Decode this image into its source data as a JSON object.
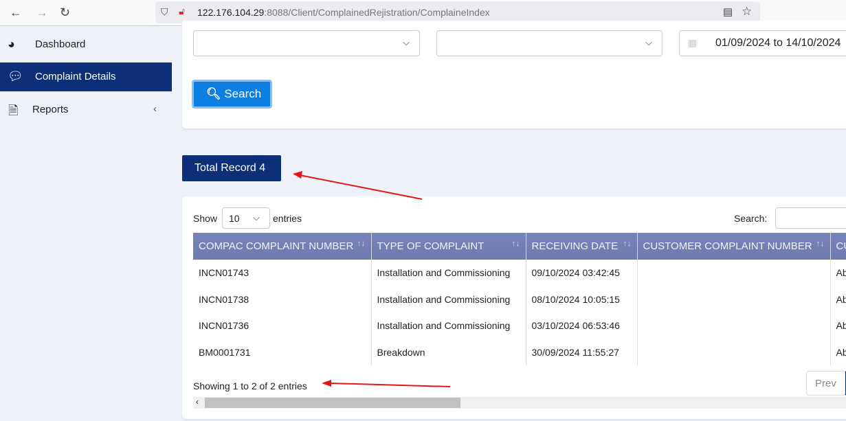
{
  "browser": {
    "url_host": "122.176.104.29",
    "url_path": ":8088/Client/ComplainedRejistration/ComplaineIndex"
  },
  "sidebar": {
    "items": [
      {
        "label": "Dashboard",
        "icon": "dashboard-gauge-icon"
      },
      {
        "label": "Complaint Details",
        "icon": "comments-icon",
        "active": true
      },
      {
        "label": "Reports",
        "icon": "document-icon"
      }
    ]
  },
  "filters": {
    "select1": "",
    "select2": "",
    "date_range": "01/09/2024 to 14/10/2024",
    "search_label": "Search"
  },
  "total_record": "Total Record 4",
  "table": {
    "show_label": "Show",
    "entries_value": "10",
    "entries_label": "entries",
    "search_label": "Search:",
    "columns": [
      "COMPAC COMPLAINT NUMBER",
      "TYPE OF COMPLAINT",
      "RECEIVING DATE",
      "CUSTOMER COMPLAINT NUMBER",
      "CU"
    ],
    "rows": [
      [
        "INCN01743",
        "Installation and Commissioning",
        "09/10/2024 03:42:45",
        "",
        "Ab"
      ],
      [
        "INCN01738",
        "Installation and Commissioning",
        "08/10/2024 10:05:15",
        "",
        "Ab"
      ],
      [
        "INCN01736",
        "Installation and Commissioning",
        "03/10/2024 06:53:46",
        "",
        "Ab"
      ],
      [
        "BM0001731",
        "Breakdown",
        "30/09/2024 11:55:27",
        "",
        "Ab"
      ]
    ],
    "info": "Showing 1 to 2 of 2 entries",
    "prev_label": "Prev"
  },
  "colors": {
    "primary": "#0d2f7a",
    "search_button": "#0d7fe0",
    "header": "#7380b6",
    "annotation": "#e81414"
  }
}
